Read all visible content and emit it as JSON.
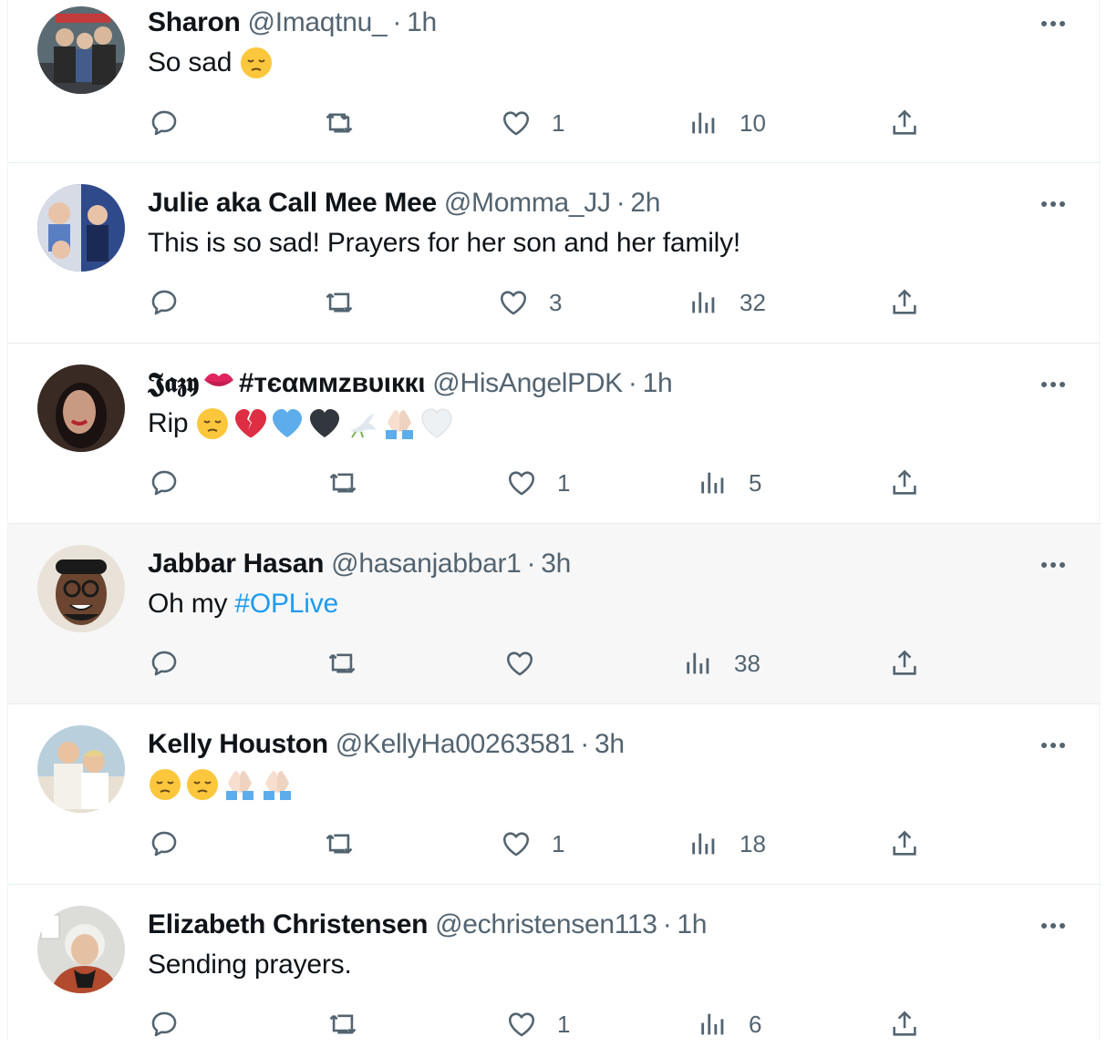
{
  "tweets": [
    {
      "name": "Sharon",
      "name_emoji": "",
      "handle": "@Imaqtnu_",
      "sep": "·",
      "time": "1h",
      "text": "So sad",
      "hashtag": "",
      "emojis": [
        "pensive"
      ],
      "replies": "",
      "retweets": "",
      "likes": "1",
      "views": "10",
      "avatar": {
        "bg": "#5b6b73",
        "c1": "#2a2a2a",
        "c2": "#d8b79a"
      }
    },
    {
      "name": "Julie aka Call Mee Mee",
      "name_emoji": "",
      "handle": "@Momma_JJ",
      "sep": "·",
      "time": "2h",
      "text": "This is so sad! Prayers for her son and her family!",
      "hashtag": "",
      "emojis": [],
      "replies": "",
      "retweets": "",
      "likes": "3",
      "views": "32",
      "avatar": {
        "bg": "#2f4a8a",
        "c1": "#1b2a55",
        "c2": "#e8c3a8"
      }
    },
    {
      "name": "𝕵𝖆𝖟𝖞",
      "name_emoji": "kiss",
      "name_suffix": "#тєαммzвυιккι",
      "handle": "@HisAngelPDK",
      "sep": "·",
      "time": "1h",
      "text": "Rip",
      "hashtag": "",
      "emojis": [
        "pensive",
        "broken-heart",
        "blue-heart",
        "black-heart",
        "dove",
        "pray",
        "white-heart"
      ],
      "replies": "",
      "retweets": "",
      "likes": "1",
      "views": "5",
      "avatar": {
        "bg": "#3a2a24",
        "c1": "#1a1210",
        "c2": "#c99a82"
      }
    },
    {
      "name": "Jabbar Hasan",
      "name_emoji": "",
      "handle": "@hasanjabbar1",
      "sep": "·",
      "time": "3h",
      "text": "Oh my",
      "hashtag": "#OPLive",
      "emojis": [],
      "replies": "",
      "retweets": "",
      "likes": "",
      "views": "38",
      "avatar": {
        "bg": "#e8e2d8",
        "c1": "#1a1a1a",
        "c2": "#6b4530"
      }
    },
    {
      "name": "Kelly Houston",
      "name_emoji": "",
      "handle": "@KellyHa00263581",
      "sep": "·",
      "time": "3h",
      "text": "",
      "hashtag": "",
      "emojis": [
        "pensive",
        "pensive",
        "pray",
        "pray"
      ],
      "replies": "",
      "retweets": "",
      "likes": "1",
      "views": "18",
      "avatar": {
        "bg": "#b9cfdc",
        "c1": "#f4f0ea",
        "c2": "#e9c2a0"
      }
    },
    {
      "name": "Elizabeth Christensen",
      "name_emoji": "",
      "handle": "@echristensen113",
      "sep": "·",
      "time": "1h",
      "text": "Sending prayers.",
      "hashtag": "",
      "emojis": [],
      "replies": "",
      "retweets": "",
      "likes": "1",
      "views": "6",
      "avatar": {
        "bg": "#dcdcd8",
        "c1": "#b24a2e",
        "c2": "#e6c0a2"
      }
    }
  ],
  "icons": {
    "reply": "reply-icon",
    "retweet": "retweet-icon",
    "like": "heart-icon",
    "views": "views-icon",
    "share": "share-icon",
    "more": "more-icon"
  },
  "colors": {
    "text": "#0f1419",
    "secondary": "#536471",
    "link": "#1d9bf0",
    "hover_bg": "#f7f7f7"
  }
}
